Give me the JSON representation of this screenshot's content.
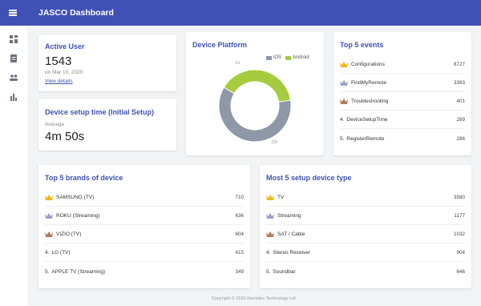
{
  "app": {
    "title": "JASCO Dashboard"
  },
  "icons": {
    "menu": "menu-icon",
    "sidebar": [
      "dashboard-icon",
      "document-icon",
      "users-icon",
      "bar-chart-icon"
    ]
  },
  "colors": {
    "primary": "#3f51b5",
    "ios": "#8e98a6",
    "android": "#a5cc3f",
    "gold": "#f0b71c",
    "silver": "#9aa3c8",
    "bronze": "#b77a5a"
  },
  "active_user": {
    "title": "Active User",
    "count": "1543",
    "date": "on Mar 10, 2020",
    "link": "View details"
  },
  "setup_time": {
    "title": "Device setup time (Initial Setup)",
    "label": "Average",
    "value": "4m 50s"
  },
  "platform": {
    "title": "Device Platform",
    "legend": [
      "iOS",
      "Android"
    ],
    "slice_labels": [
      "61",
      "326"
    ],
    "chart_data": {
      "type": "pie",
      "categories": [
        "iOS",
        "Android"
      ],
      "values": [
        61,
        39
      ]
    }
  },
  "top_events": {
    "title": "Top 5 events",
    "rows": [
      {
        "rank": "",
        "label": "Configurations",
        "value": "8727",
        "medal": "gold"
      },
      {
        "rank": "",
        "label": "FindMyRemote",
        "value": "3393",
        "medal": "silver"
      },
      {
        "rank": "",
        "label": "Troubleshooting",
        "value": "401",
        "medal": "bronze"
      },
      {
        "rank": "4.",
        "label": "DeviceSetupTime",
        "value": "289",
        "medal": ""
      },
      {
        "rank": "5.",
        "label": "RegisterRemote",
        "value": "286",
        "medal": ""
      }
    ]
  },
  "top_brands": {
    "title": "Top 5 brands of device",
    "rows": [
      {
        "rank": "",
        "label": "SAMSUNG (TV)",
        "value": "710",
        "medal": "gold"
      },
      {
        "rank": "",
        "label": "ROKU (Streaming)",
        "value": "636",
        "medal": "silver"
      },
      {
        "rank": "",
        "label": "VIZIO (TV)",
        "value": "604",
        "medal": "bronze"
      },
      {
        "rank": "4.",
        "label": "LG (TV)",
        "value": "415",
        "medal": ""
      },
      {
        "rank": "5.",
        "label": "APPLE TV (Streaming)",
        "value": "349",
        "medal": ""
      }
    ]
  },
  "top_types": {
    "title": "Most 5 setup device type",
    "rows": [
      {
        "rank": "",
        "label": "TV",
        "value": "3580",
        "medal": "gold"
      },
      {
        "rank": "",
        "label": "Streaming",
        "value": "1177",
        "medal": "silver"
      },
      {
        "rank": "",
        "label": "SAT / Cable",
        "value": "1032",
        "medal": "bronze"
      },
      {
        "rank": "4.",
        "label": "Stereo Receiver",
        "value": "904",
        "medal": ""
      },
      {
        "rank": "5.",
        "label": "Soundbar",
        "value": "646",
        "medal": ""
      }
    ]
  },
  "footer": {
    "text": "Copyright © 2020 Remotec Technology Ltd."
  }
}
